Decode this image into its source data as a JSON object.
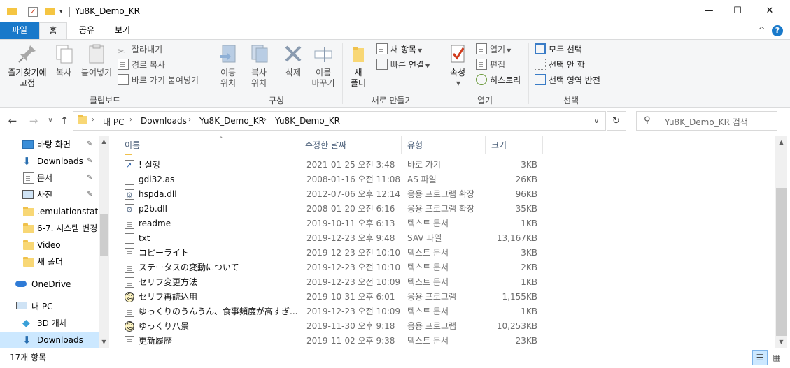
{
  "window": {
    "title": "Yu8K_Demo_KR",
    "quick_access_more": "▾",
    "minimize": "—",
    "maximize": "☐",
    "close": "✕"
  },
  "ribbon_tabs": {
    "file": "파일",
    "home": "홈",
    "share": "공유",
    "view": "보기",
    "collapse": "^",
    "help": "?"
  },
  "ribbon": {
    "clipboard": {
      "label": "클립보드",
      "pin": "즐겨찾기에\n고정",
      "copy": "복사",
      "paste": "붙여넣기",
      "cut": "잘라내기",
      "copy_path": "경로 복사",
      "paste_shortcut": "바로 가기 붙여넣기"
    },
    "organize": {
      "label": "구성",
      "move_to": "이동\n위치",
      "copy_to": "복사\n위치",
      "delete": "삭제",
      "rename": "이름\n바꾸기"
    },
    "new": {
      "label": "새로 만들기",
      "new_folder": "새\n폴더",
      "new_item": "새 항목",
      "easy_access": "빠른 연결"
    },
    "open": {
      "label": "열기",
      "properties": "속성",
      "open": "열기",
      "edit": "편집",
      "history": "히스토리"
    },
    "select": {
      "label": "선택",
      "select_all": "모두 선택",
      "select_none": "선택 안 함",
      "invert": "선택 영역 반전"
    }
  },
  "nav": {
    "back": "←",
    "forward": "→",
    "recent": "∨",
    "up": "↑",
    "breadcrumb": [
      "내 PC",
      "Downloads",
      "Yu8K_Demo_KR",
      "Yu8K_Demo_KR"
    ],
    "crumb_sep": "›",
    "dropdown": "∨",
    "refresh": "↻",
    "search_placeholder": "Yu8K_Demo_KR 검색"
  },
  "sidebar": {
    "items": [
      {
        "label": "바탕 화면",
        "icon": "desktop-icon",
        "pinned": true
      },
      {
        "label": "Downloads",
        "icon": "download-icon",
        "pinned": true
      },
      {
        "label": "문서",
        "icon": "document-icon",
        "pinned": true
      },
      {
        "label": "사진",
        "icon": "picture-icon",
        "pinned": true
      },
      {
        "label": ".emulationstatio",
        "icon": "folder-icon",
        "pinned": false
      },
      {
        "label": "6-7. 시스템 변경",
        "icon": "folder-icon",
        "pinned": false
      },
      {
        "label": "Video",
        "icon": "folder-icon",
        "pinned": false
      },
      {
        "label": "새 폴더",
        "icon": "folder-icon",
        "pinned": false
      },
      {
        "label": "OneDrive",
        "icon": "cloud-icon",
        "pinned": false
      },
      {
        "label": "내 PC",
        "icon": "pc-icon",
        "pinned": false
      },
      {
        "label": "3D 개체",
        "icon": "cube-icon",
        "pinned": false
      },
      {
        "label": "Downloads",
        "icon": "download-icon",
        "pinned": false,
        "selected": true
      }
    ],
    "pin_glyph": "📌"
  },
  "columns": {
    "name": "이름",
    "date": "수정한 날짜",
    "type": "유형",
    "size": "크기",
    "sort_indicator": "^"
  },
  "files": [
    {
      "name": "! 실행",
      "date": "2021-01-25 오전 3:48",
      "type": "바로 가기",
      "size": "3KB",
      "icon": "shortcut-icon"
    },
    {
      "name": "gdi32.as",
      "date": "2008-01-16 오전 11:08",
      "type": "AS 파일",
      "size": "26KB",
      "icon": "file-icon"
    },
    {
      "name": "hspda.dll",
      "date": "2012-07-06 오후 12:14",
      "type": "응용 프로그램 확장",
      "size": "96KB",
      "icon": "dll-icon"
    },
    {
      "name": "p2b.dll",
      "date": "2008-01-20 오전 6:16",
      "type": "응용 프로그램 확장",
      "size": "35KB",
      "icon": "dll-icon"
    },
    {
      "name": "readme",
      "date": "2019-10-11 오후 6:13",
      "type": "텍스트 문서",
      "size": "1KB",
      "icon": "text-file-icon"
    },
    {
      "name": "txt",
      "date": "2019-12-23 오후 9:48",
      "type": "SAV 파일",
      "size": "13,167KB",
      "icon": "file-icon"
    },
    {
      "name": "コピーライト",
      "date": "2019-12-23 오전 10:10",
      "type": "텍스트 문서",
      "size": "3KB",
      "icon": "text-file-icon"
    },
    {
      "name": "ステータスの変動について",
      "date": "2019-12-23 오전 10:10",
      "type": "텍스트 문서",
      "size": "2KB",
      "icon": "text-file-icon"
    },
    {
      "name": "セリフ変更方法",
      "date": "2019-12-23 오전 10:09",
      "type": "텍스트 문서",
      "size": "1KB",
      "icon": "text-file-icon"
    },
    {
      "name": "セリフ再読込用",
      "date": "2019-10-31 오후 6:01",
      "type": "응용 프로그램",
      "size": "1,155KB",
      "icon": "app-face-icon"
    },
    {
      "name": "ゆっくりのうんうん、食事頻度が高すぎ...",
      "date": "2019-12-23 오전 10:09",
      "type": "텍스트 문서",
      "size": "1KB",
      "icon": "text-file-icon"
    },
    {
      "name": "ゆっくり八景",
      "date": "2019-11-30 오후 9:18",
      "type": "응용 프로그램",
      "size": "10,253KB",
      "icon": "app-face-icon"
    },
    {
      "name": "更新履歴",
      "date": "2019-11-02 오후 9:38",
      "type": "텍스트 문서",
      "size": "23KB",
      "icon": "text-file-icon"
    }
  ],
  "status": {
    "item_count": "17개 항목"
  },
  "colors": {
    "accent": "#1979ca",
    "selection": "#cce8ff",
    "ribbon_bg": "#f5f6f7"
  }
}
